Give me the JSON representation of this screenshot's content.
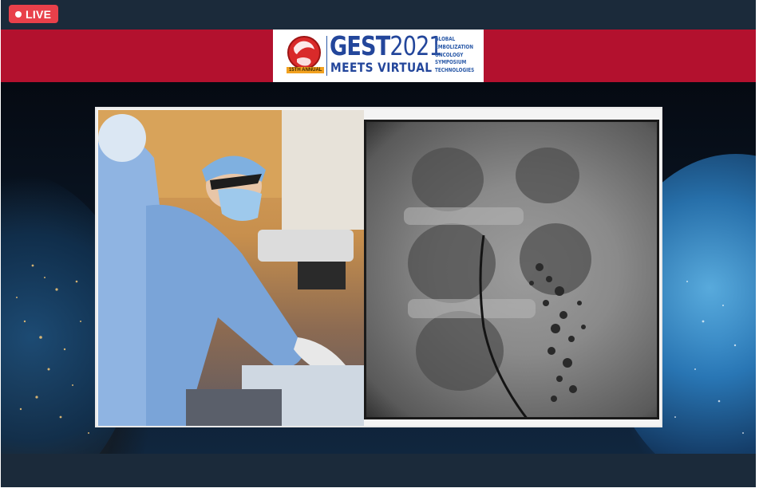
{
  "live_badge": {
    "label": "LIVE",
    "color": "#e8404a"
  },
  "banner": {
    "color": "#b3112e",
    "logo": {
      "gest": "GEST",
      "year": "2021",
      "meets": "MEETS VIRTUAL",
      "annual": "15TH ANNUAL",
      "words": [
        "GLOBAL",
        "EMBOLIZATION",
        "ONCOLOGY",
        "SYMPOSIUM",
        "TECHNOLOGIES"
      ]
    }
  },
  "video": {
    "left_panel": "operating-room-camera",
    "right_panel": "fluoroscopy-feed"
  },
  "colors": {
    "chrome": "#1b2a3a",
    "logo_blue": "#23469b"
  }
}
